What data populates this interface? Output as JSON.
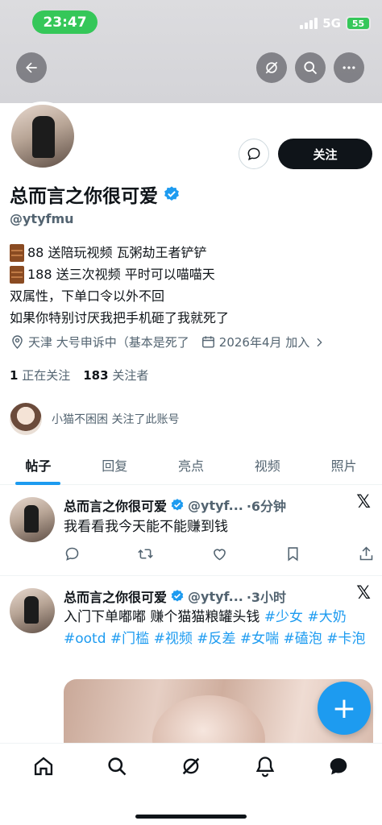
{
  "status": {
    "time": "23:47",
    "network": "5G",
    "battery": "55"
  },
  "header": {
    "back_icon": "arrow-left-icon",
    "grok_icon": "grok-icon",
    "search_icon": "search-icon",
    "more_icon": "more-icon"
  },
  "profile": {
    "follow_label": "关注",
    "name": "总而言之你很可爱",
    "handle": "@ytyfmu",
    "bio": [
      "88 送陪玩视频 瓦粥劫王者铲铲",
      "188 送三次视频 平时可以喵喵天",
      "双属性，下单口令以外不回",
      "如果你特别讨厌我把手机砸了我就死了"
    ],
    "location": "天津 大号申诉中（基本是死了",
    "joined": "2026年4月 加入",
    "following_count": "1",
    "following_label": "正在关注",
    "followers_count": "183",
    "followers_label": "关注者",
    "followed_by": "小猫不困困 关注了此账号"
  },
  "tabs": [
    "帖子",
    "回复",
    "亮点",
    "视频",
    "照片"
  ],
  "posts": [
    {
      "name": "总而言之你很可爱",
      "handle": "@ytyf...",
      "time": "·6分钟",
      "text": "我看看我今天能不能赚到钱"
    },
    {
      "name": "总而言之你很可爱",
      "handle": "@ytyf...",
      "time": "·3小时",
      "text_plain": "入门下单嘟嘟 赚个猫猫粮罐头钱 ",
      "tags": [
        "#少女",
        "#大奶",
        "#ootd",
        "#门槛",
        "#视频",
        "#反差",
        "#女喘",
        "#磕泡",
        "#卡泡"
      ]
    }
  ],
  "fab_label": "+",
  "colors": {
    "accent": "#1d9bf0",
    "status_green": "#35c759",
    "text": "#0f1419",
    "muted": "#536471"
  }
}
